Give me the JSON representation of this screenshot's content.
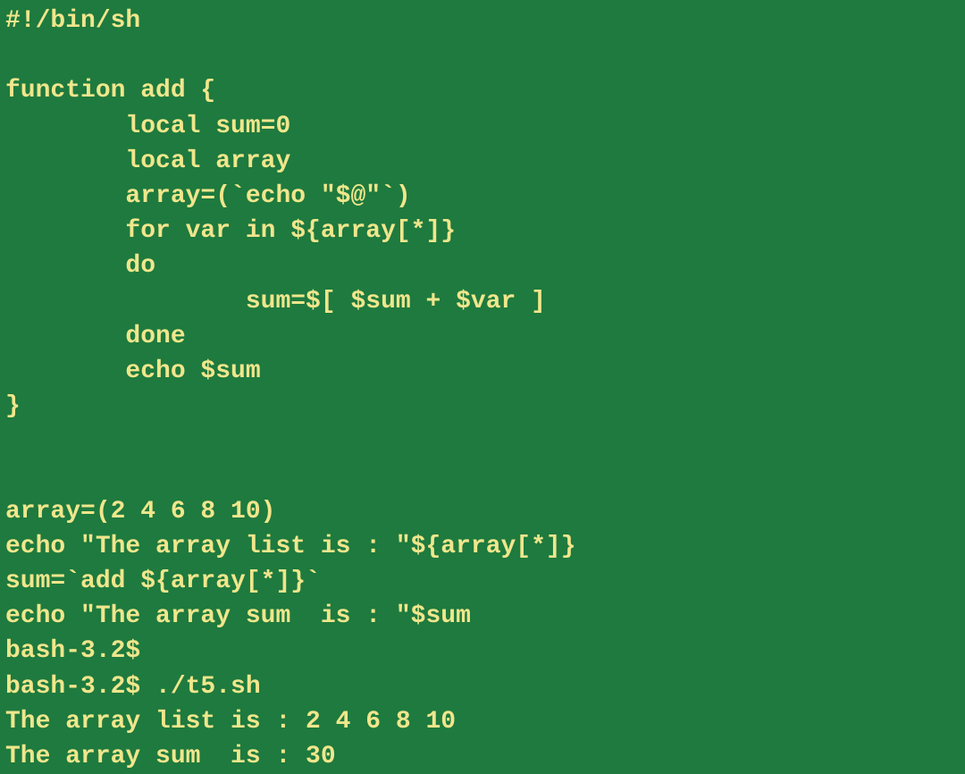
{
  "colors": {
    "background": "#1e7a3e",
    "foreground": "#f0e68c"
  },
  "lines": {
    "l0": "#!/bin/sh",
    "l1": "",
    "l2": "function add {",
    "l3": "        local sum=0",
    "l4": "        local array",
    "l5": "        array=(`echo \"$@\"`)",
    "l6": "        for var in ${array[*]}",
    "l7": "        do",
    "l8": "                sum=$[ $sum + $var ]",
    "l9": "        done",
    "l10": "        echo $sum",
    "l11": "}",
    "l12": "",
    "l13": "",
    "l14": "array=(2 4 6 8 10)",
    "l15": "echo \"The array list is : \"${array[*]}",
    "l16": "sum=`add ${array[*]}`",
    "l17": "echo \"The array sum  is : \"$sum",
    "l18": "bash-3.2$ ",
    "l19": "bash-3.2$ ./t5.sh",
    "l20": "The array list is : 2 4 6 8 10",
    "l21": "The array sum  is : 30"
  }
}
